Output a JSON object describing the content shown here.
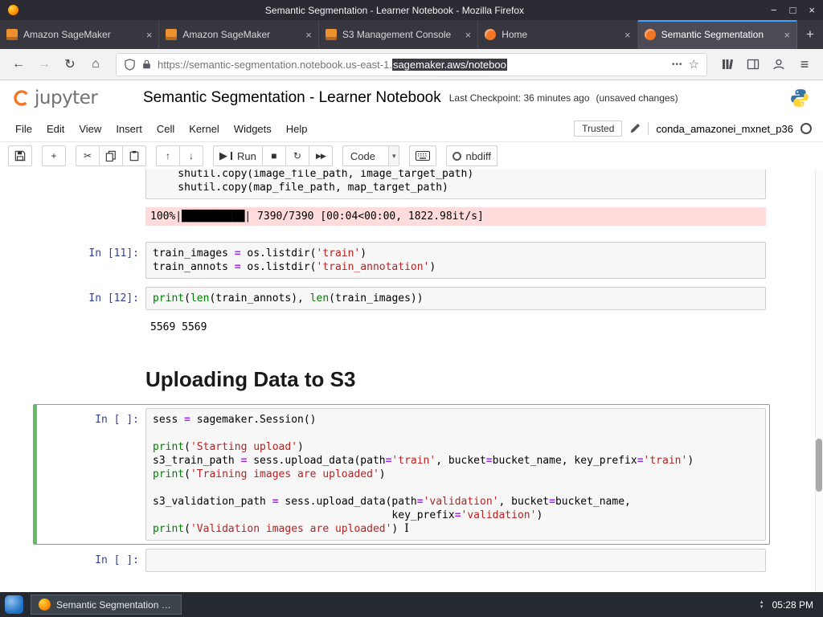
{
  "window": {
    "title": "Semantic Segmentation - Learner Notebook - Mozilla Firefox"
  },
  "browser": {
    "tabs": [
      {
        "label": "Amazon SageMaker",
        "icon": "aws",
        "active": false
      },
      {
        "label": "Amazon SageMaker",
        "icon": "aws",
        "active": false
      },
      {
        "label": "S3 Management Console",
        "icon": "aws",
        "active": false
      },
      {
        "label": "Home",
        "icon": "jupyter",
        "active": false
      },
      {
        "label": "Semantic Segmentation",
        "icon": "jupyter",
        "active": true
      }
    ],
    "url": {
      "prefix": "https://semantic-segmentation.notebook.us-east-1.",
      "selected": "sagemaker.aws/noteboo"
    }
  },
  "jupyter": {
    "logo": "jupyter",
    "title": "Semantic Segmentation - Learner Notebook",
    "checkpoint": "Last Checkpoint: 36 minutes ago",
    "autosave": "(unsaved changes)",
    "menu": [
      "File",
      "Edit",
      "View",
      "Insert",
      "Cell",
      "Kernel",
      "Widgets",
      "Help"
    ],
    "trusted": "Trusted",
    "kernel": "conda_amazonei_mxnet_p36",
    "toolbar": {
      "run": "Run",
      "cell_type": "Code",
      "nbdiff": "nbdiff"
    }
  },
  "notebook": {
    "cells": [
      {
        "kind": "code",
        "prompt": "",
        "clipped": true,
        "source": [
          "    shutil.copy(image_file_path, image_target_path)",
          "    shutil.copy(map_file_path, map_target_path)"
        ]
      },
      {
        "kind": "stream",
        "prompt": "",
        "text": "100%|██████████| 7390/7390 [00:04<00:00, 1822.98it/s]"
      },
      {
        "kind": "code",
        "prompt": "In [11]:",
        "source": [
          "train_images = os.listdir('train')",
          "train_annots = os.listdir('train_annotation')"
        ]
      },
      {
        "kind": "code",
        "prompt": "In [12]:",
        "source": [
          "print(len(train_annots), len(train_images))"
        ]
      },
      {
        "kind": "output",
        "prompt": "",
        "text": "5569 5569"
      },
      {
        "kind": "markdown",
        "prompt": "",
        "text": "Uploading Data to S3"
      },
      {
        "kind": "code",
        "prompt": "In [ ]:",
        "selected": true,
        "cursor": true,
        "source": [
          "sess = sagemaker.Session()",
          "",
          "print('Starting upload')",
          "s3_train_path = sess.upload_data(path='train', bucket=bucket_name, key_prefix='train')",
          "print('Training images are uploaded')",
          "",
          "s3_validation_path = sess.upload_data(path='validation', bucket=bucket_name,",
          "                                      key_prefix='validation')",
          "print('Validation images are uploaded')"
        ]
      },
      {
        "kind": "code",
        "prompt": "In [ ]:",
        "source": [
          ""
        ]
      }
    ]
  },
  "taskbar": {
    "task": "Semantic Segmentation - Le...",
    "clock": "05:28 PM"
  },
  "icons": {
    "close": "×",
    "new_tab": "+",
    "minimize": "−",
    "maximize": "□",
    "close_window": "×",
    "back": "←",
    "forward": "→",
    "reload": "↻",
    "home": "⌂",
    "page_actions": "•••",
    "bookmark": "☆",
    "menu": "≡",
    "add": "+",
    "cut": "✂",
    "up": "↑",
    "down": "↓",
    "run": "▶",
    "stop": "■",
    "refresh": "↻",
    "fastforward": "▶▶",
    "caret": "▾",
    "ibeam": "I",
    "arrow_up": "▲",
    "arrow_down": "▼"
  }
}
